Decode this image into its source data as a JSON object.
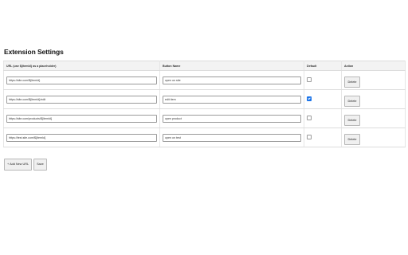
{
  "page": {
    "title": "Extension Settings"
  },
  "table": {
    "headers": {
      "url": "URL (use ${itemId} as a placeholder)",
      "name": "Button Name",
      "default": "Default",
      "action": "Action"
    },
    "rows": [
      {
        "url": "https://site.com/${itemId}",
        "name": "open on site",
        "default": false,
        "delete_label": "Delete"
      },
      {
        "url": "https://site.com/${itemId}/edit",
        "name": "edit item",
        "default": true,
        "delete_label": "Delete"
      },
      {
        "url": "https://site.com/products/${itemId}",
        "name": "open product",
        "default": false,
        "delete_label": "Delete"
      },
      {
        "url": "https://test.site.com/${itemId}",
        "name": "open on test",
        "default": false,
        "delete_label": "Delete"
      }
    ]
  },
  "actions": {
    "add_label": "+ Add New URL",
    "save_label": "Save"
  },
  "colors": {
    "checkbox_checked": "#1a73e8",
    "header_bg": "#f3f3f3"
  }
}
